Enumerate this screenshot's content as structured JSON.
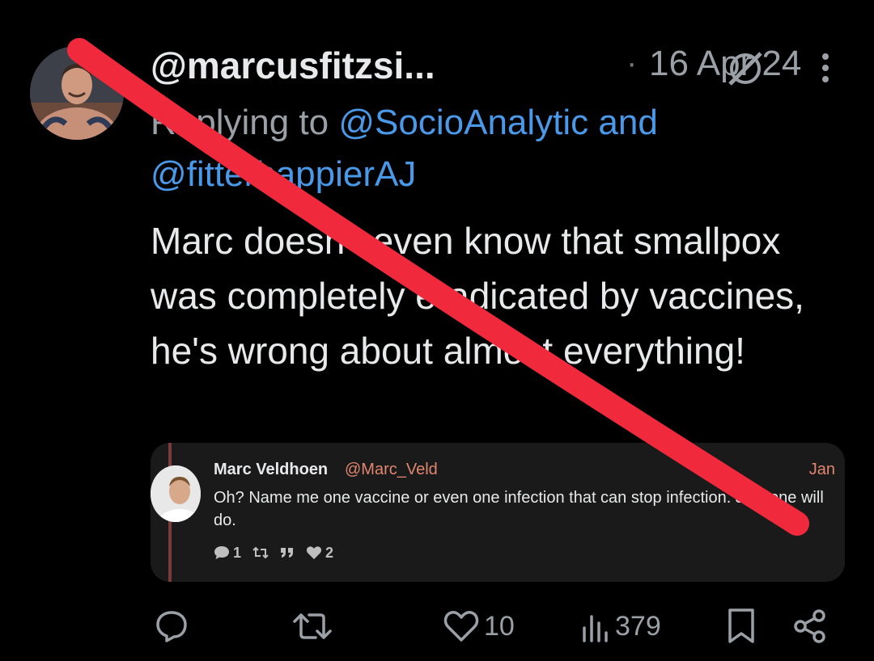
{
  "tweet": {
    "handle": "@marcusfitzsi...",
    "separator": "·",
    "date": "16 Apr 24",
    "replying_prefix": "Replying to ",
    "replying_mentions": "@SocioAnalytic and @fitterhappierAJ",
    "text": "Marc doesn't even know that smallpox was completely eradicated by vaccines, he's wrong about almost everything!"
  },
  "quoted": {
    "name": "Marc Veldhoen",
    "handle": "@Marc_Veld",
    "date": "Jan",
    "text": "Oh? Name me one vaccine or even one infection that can stop infection. Just one will do.",
    "replies": "1",
    "likes": "2"
  },
  "actions": {
    "likes": "10",
    "views": "379"
  },
  "icons": {
    "grok": "grok-icon",
    "more": "more-icon",
    "reply": "reply-icon",
    "retweet": "retweet-icon",
    "like": "heart-icon",
    "views": "views-icon",
    "bookmark": "bookmark-icon",
    "share": "share-icon"
  },
  "colors": {
    "background": "#000000",
    "text": "#e7e9ea",
    "muted": "#9aa0a6",
    "link": "#4a99e9",
    "strike": "#f02a3c",
    "quote_bg": "#1a1a1a",
    "quote_accent": "#e0866f"
  }
}
